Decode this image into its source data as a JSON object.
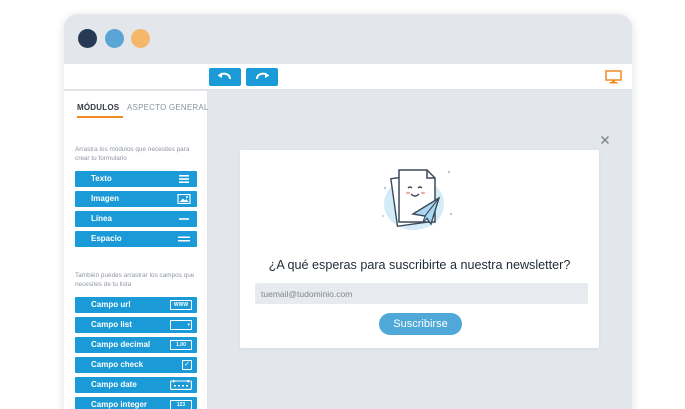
{
  "toolbar": {
    "undo_icon": "undo-arrow-icon",
    "redo_icon": "redo-arrow-icon",
    "preview_icon": "monitor-icon",
    "accent_color": "#1a9ad6",
    "preview_color": "#f28a22"
  },
  "sidebar": {
    "tabs": [
      {
        "label": "MÓDULOS",
        "active": true
      },
      {
        "label": "ASPECTO GENERAL",
        "active": false
      }
    ],
    "modules_hint": "Arrastra los módulos que necesites para crear tu formulario",
    "modules": [
      {
        "label": "Texto",
        "icon": "text-lines-icon"
      },
      {
        "label": "Imagen",
        "icon": "image-icon"
      },
      {
        "label": "Línea",
        "icon": "line-icon"
      },
      {
        "label": "Espacio",
        "icon": "spacer-icon"
      }
    ],
    "fields_hint": "También puedes arrastrar los campos que necesites de tu lista",
    "fields": [
      {
        "label": "Campo url",
        "badge": "WWW",
        "icon": "url-field-icon"
      },
      {
        "label": "Campo list",
        "badge": "▾",
        "icon": "dropdown-field-icon"
      },
      {
        "label": "Campo decimal",
        "badge": "1.00",
        "icon": "decimal-field-icon"
      },
      {
        "label": "Campo check",
        "badge": "✓",
        "icon": "checkbox-field-icon"
      },
      {
        "label": "Campo date",
        "badge": "",
        "icon": "date-field-icon"
      },
      {
        "label": "Campo integer",
        "badge": "123",
        "icon": "integer-field-icon"
      }
    ]
  },
  "form": {
    "close_icon": "close-icon",
    "illustration": "newsletter-paper-plane-illustration",
    "headline": "¿A qué esperas para suscribirte a nuestra newsletter?",
    "email_placeholder": "tuemail@tudominio.com",
    "submit_label": "Suscribirse",
    "button_color": "#4fa8d8"
  }
}
